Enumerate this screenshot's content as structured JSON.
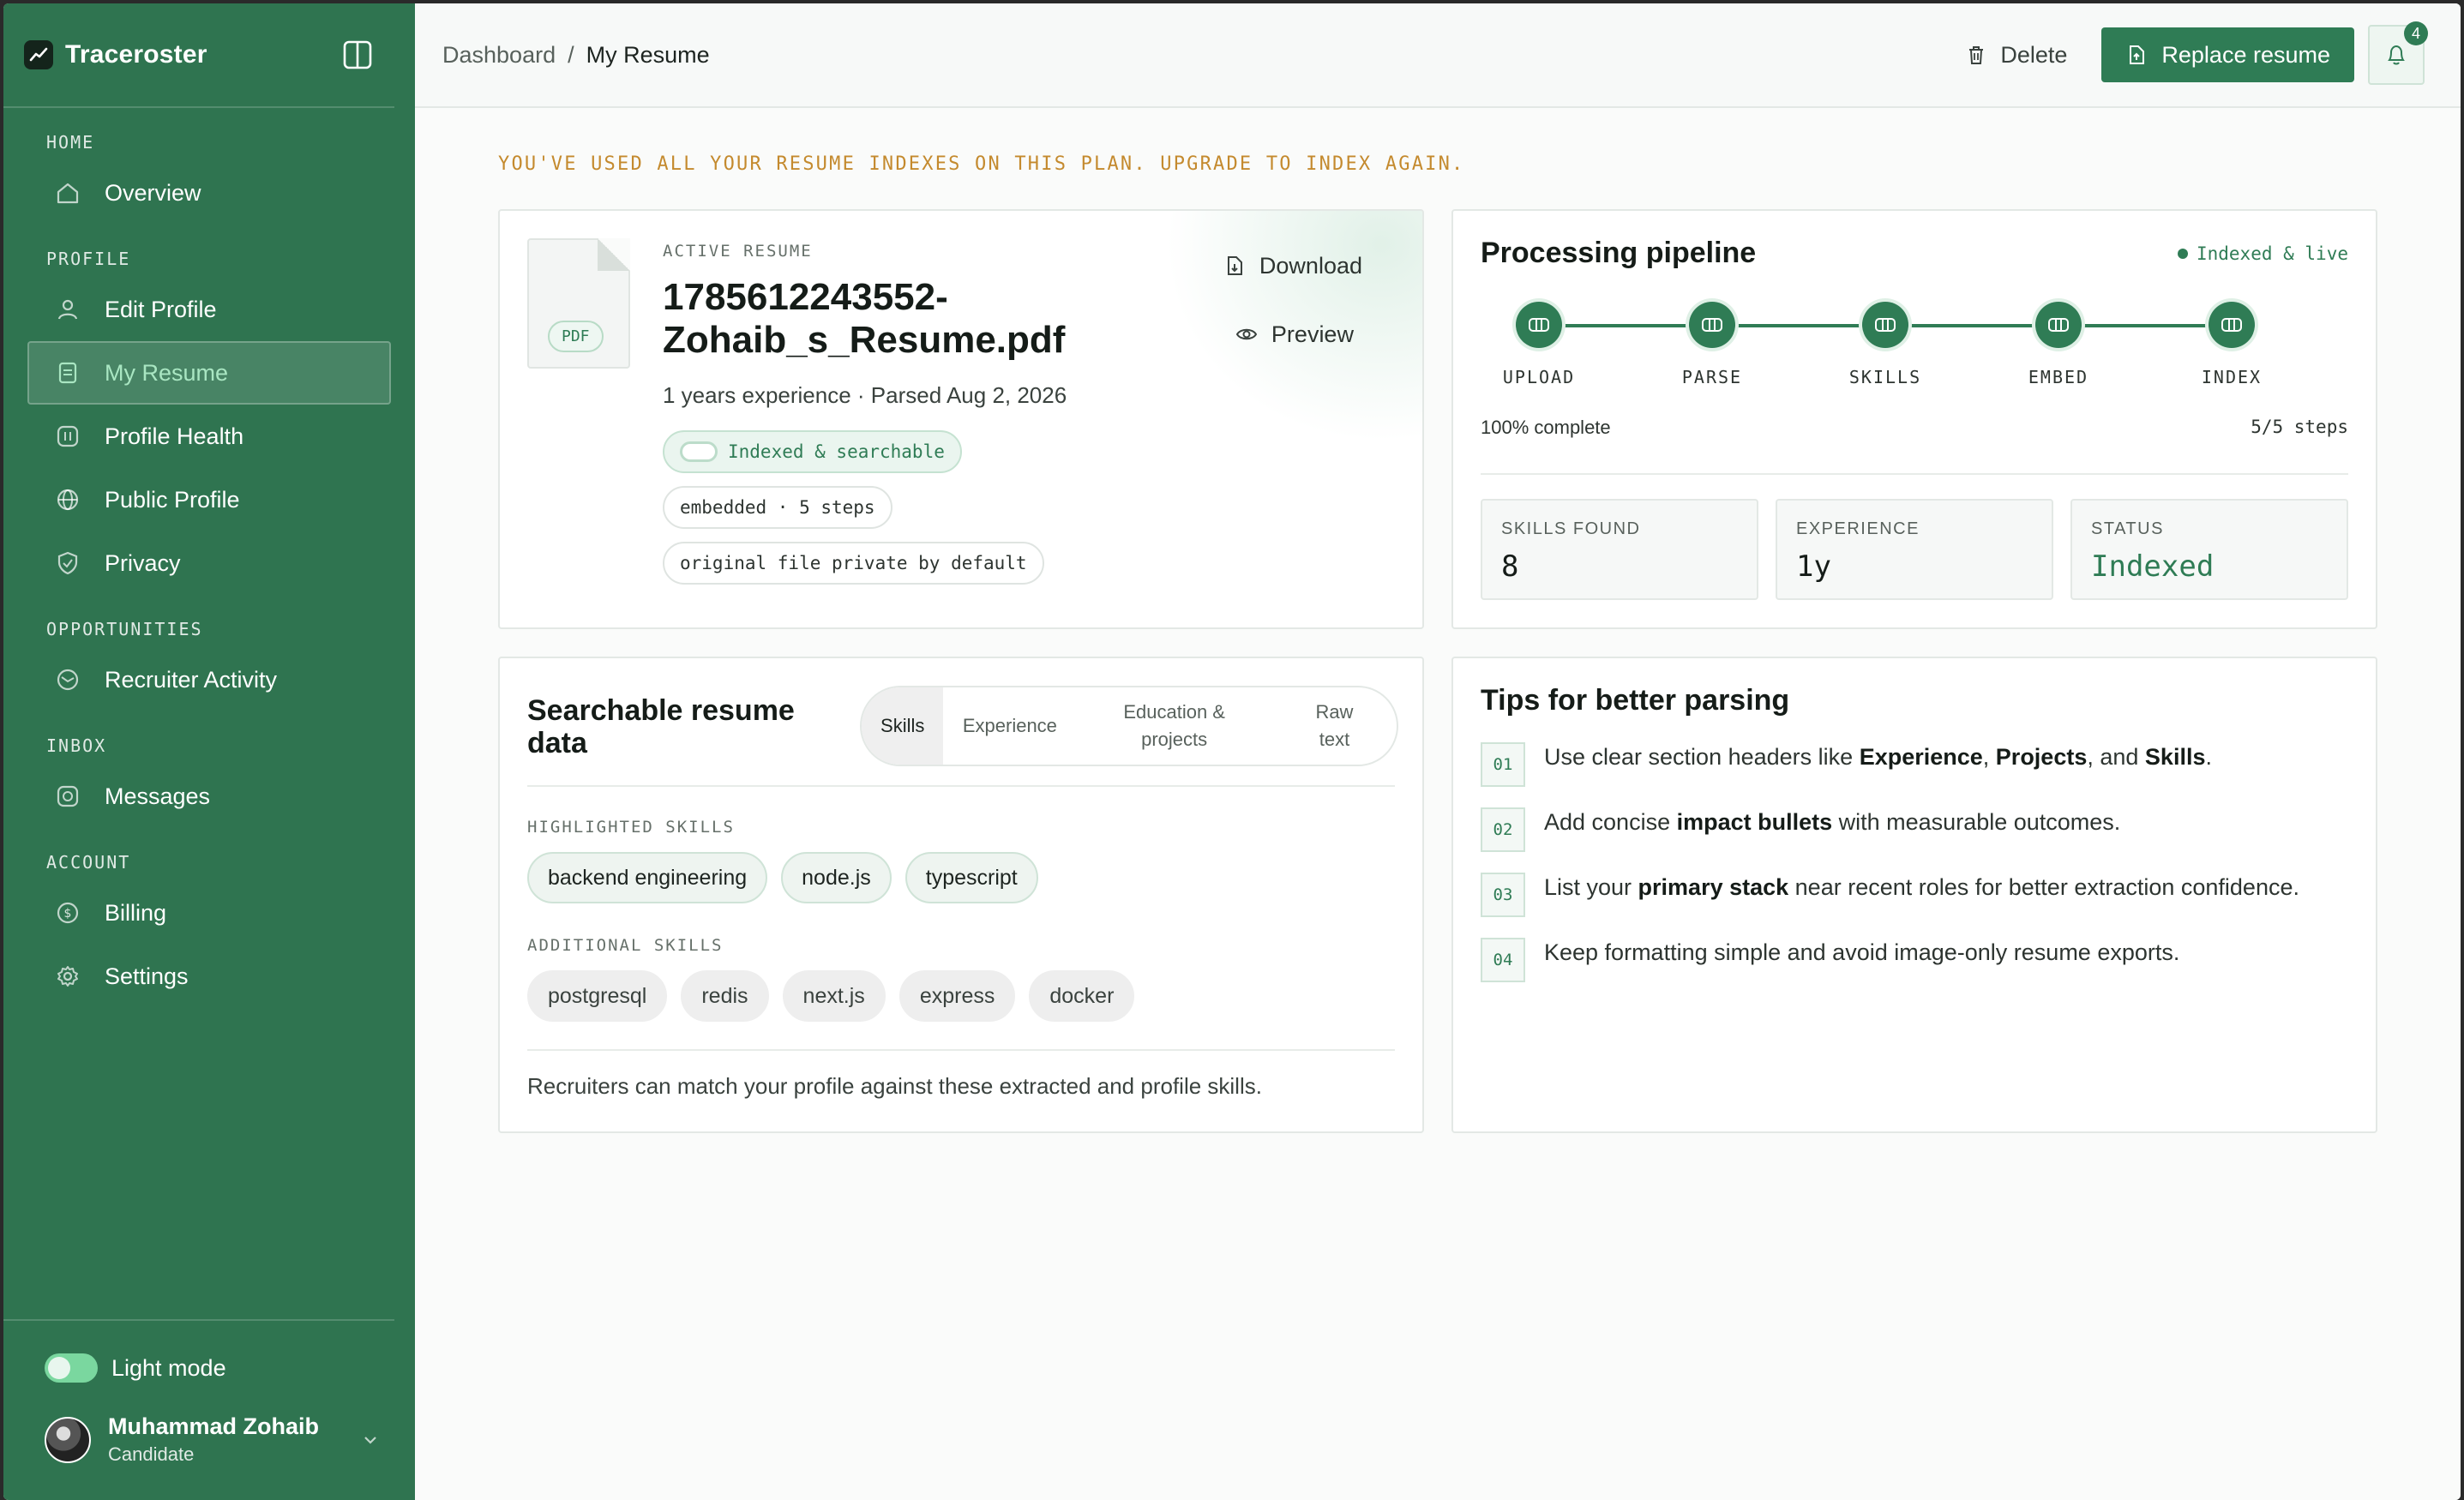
{
  "app": {
    "name": "Traceroster"
  },
  "breadcrumb": {
    "parent": "Dashboard",
    "separator": "/",
    "current": "My Resume"
  },
  "topbar": {
    "delete_label": "Delete",
    "replace_label": "Replace resume",
    "notif_count": "4"
  },
  "sidebar": {
    "sections": [
      {
        "label": "HOME",
        "items": [
          {
            "label": "Overview",
            "icon": "home-icon"
          }
        ]
      },
      {
        "label": "PROFILE",
        "items": [
          {
            "label": "Edit Profile",
            "icon": "user-icon"
          },
          {
            "label": "My Resume",
            "icon": "document-icon",
            "active": true
          },
          {
            "label": "Profile Health",
            "icon": "health-icon"
          },
          {
            "label": "Public Profile",
            "icon": "globe-icon"
          },
          {
            "label": "Privacy",
            "icon": "shield-icon"
          }
        ]
      },
      {
        "label": "OPPORTUNITIES",
        "items": [
          {
            "label": "Recruiter Activity",
            "icon": "activity-icon"
          }
        ]
      },
      {
        "label": "INBOX",
        "items": [
          {
            "label": "Messages",
            "icon": "message-icon"
          }
        ]
      },
      {
        "label": "ACCOUNT",
        "items": [
          {
            "label": "Billing",
            "icon": "dollar-icon"
          },
          {
            "label": "Settings",
            "icon": "gear-icon"
          }
        ]
      }
    ],
    "mode_label": "Light mode",
    "user": {
      "name": "Muhammad Zohaib",
      "role": "Candidate"
    }
  },
  "warning": "YOU'VE USED ALL YOUR RESUME INDEXES ON THIS PLAN. UPGRADE TO INDEX AGAIN.",
  "resume": {
    "section_label": "ACTIVE RESUME",
    "file_type": "PDF",
    "file_name_line1": "1785612243552-",
    "file_name_line2": "Zohaib_s_Resume.pdf",
    "meta": "1 years experience · Parsed Aug 2, 2026",
    "chips": [
      "Indexed & searchable",
      "embedded · 5 steps",
      "original file private by default"
    ],
    "download_label": "Download",
    "preview_label": "Preview"
  },
  "pipeline": {
    "title": "Processing pipeline",
    "status": "Indexed & live",
    "steps": [
      "UPLOAD",
      "PARSE",
      "SKILLS",
      "EMBED",
      "INDEX"
    ],
    "progress_text": "100% complete",
    "steps_text": "5/5 steps",
    "stats": [
      {
        "label": "SKILLS FOUND",
        "value": "8"
      },
      {
        "label": "EXPERIENCE",
        "value": "1y"
      },
      {
        "label": "STATUS",
        "value": "Indexed"
      }
    ]
  },
  "searchable": {
    "title": "Searchable resume data",
    "tabs": [
      "Skills",
      "Experience",
      "Education & projects",
      "Raw text"
    ],
    "highlighted_label": "HIGHLIGHTED SKILLS",
    "highlighted": [
      "backend engineering",
      "node.js",
      "typescript"
    ],
    "additional_label": "ADDITIONAL SKILLS",
    "additional": [
      "postgresql",
      "redis",
      "next.js",
      "express",
      "docker"
    ],
    "footer": "Recruiters can match your profile against these extracted and profile skills."
  },
  "tips": {
    "title": "Tips for better parsing",
    "items": [
      {
        "num": "01",
        "pre": "Use clear section headers like ",
        "b1": "Experience",
        "mid1": ", ",
        "b2": "Projects",
        "mid2": ", and ",
        "b3": "Skills",
        "post": "."
      },
      {
        "num": "02",
        "pre": "Add concise ",
        "b1": "impact bullets",
        "post": " with measurable outcomes."
      },
      {
        "num": "03",
        "pre": "List your ",
        "b1": "primary stack",
        "post": " near recent roles for better extraction confidence."
      },
      {
        "num": "04",
        "text": "Keep formatting simple and avoid image-only resume exports."
      }
    ]
  }
}
